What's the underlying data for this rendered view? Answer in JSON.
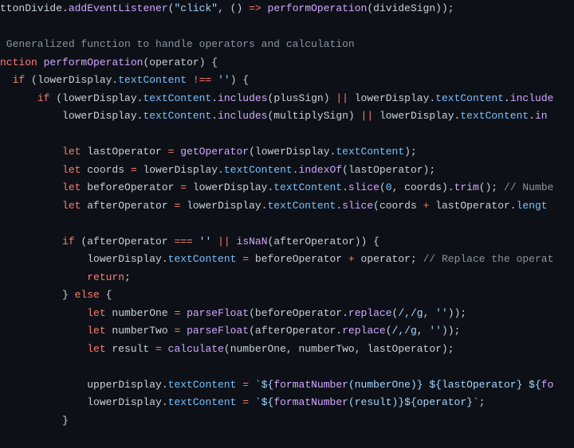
{
  "code": {
    "lines": [
      {
        "indent": 0,
        "segs": [
          {
            "c": "v",
            "t": "ttonDivide"
          },
          {
            "c": "p",
            "t": "."
          },
          {
            "c": "fn",
            "t": "addEventListener"
          },
          {
            "c": "p",
            "t": "("
          },
          {
            "c": "s",
            "t": "\"click\""
          },
          {
            "c": "p",
            "t": ", () "
          },
          {
            "c": "op",
            "t": "=>"
          },
          {
            "c": "p",
            "t": " "
          },
          {
            "c": "fn",
            "t": "performOperation"
          },
          {
            "c": "p",
            "t": "(divideSign));"
          }
        ]
      },
      {
        "indent": 0,
        "segs": []
      },
      {
        "indent": 0,
        "segs": [
          {
            "c": "c",
            "t": " Generalized function to handle operators and calculation"
          }
        ]
      },
      {
        "indent": 0,
        "segs": [
          {
            "c": "k",
            "t": "nction"
          },
          {
            "c": "p",
            "t": " "
          },
          {
            "c": "fn",
            "t": "performOperation"
          },
          {
            "c": "p",
            "t": "("
          },
          {
            "c": "v",
            "t": "operator"
          },
          {
            "c": "p",
            "t": ") {"
          }
        ]
      },
      {
        "indent": 2,
        "segs": [
          {
            "c": "k",
            "t": "if"
          },
          {
            "c": "p",
            "t": " (lowerDisplay."
          },
          {
            "c": "pr",
            "t": "textContent"
          },
          {
            "c": "p",
            "t": " "
          },
          {
            "c": "op",
            "t": "!=="
          },
          {
            "c": "p",
            "t": " "
          },
          {
            "c": "s",
            "t": "''"
          },
          {
            "c": "p",
            "t": ") {"
          }
        ]
      },
      {
        "indent": 6,
        "segs": [
          {
            "c": "k",
            "t": "if"
          },
          {
            "c": "p",
            "t": " (lowerDisplay."
          },
          {
            "c": "pr",
            "t": "textContent"
          },
          {
            "c": "p",
            "t": "."
          },
          {
            "c": "fn",
            "t": "includes"
          },
          {
            "c": "p",
            "t": "(plusSign) "
          },
          {
            "c": "op",
            "t": "||"
          },
          {
            "c": "p",
            "t": " lowerDisplay."
          },
          {
            "c": "pr",
            "t": "textContent"
          },
          {
            "c": "p",
            "t": "."
          },
          {
            "c": "fn",
            "t": "include"
          }
        ]
      },
      {
        "indent": 10,
        "segs": [
          {
            "c": "p",
            "t": "lowerDisplay."
          },
          {
            "c": "pr",
            "t": "textContent"
          },
          {
            "c": "p",
            "t": "."
          },
          {
            "c": "fn",
            "t": "includes"
          },
          {
            "c": "p",
            "t": "(multiplySign) "
          },
          {
            "c": "op",
            "t": "||"
          },
          {
            "c": "p",
            "t": " lowerDisplay."
          },
          {
            "c": "pr",
            "t": "textContent"
          },
          {
            "c": "p",
            "t": "."
          },
          {
            "c": "fn",
            "t": "in"
          }
        ]
      },
      {
        "indent": 0,
        "segs": []
      },
      {
        "indent": 10,
        "segs": [
          {
            "c": "k",
            "t": "let"
          },
          {
            "c": "p",
            "t": " lastOperator "
          },
          {
            "c": "op",
            "t": "="
          },
          {
            "c": "p",
            "t": " "
          },
          {
            "c": "fn",
            "t": "getOperator"
          },
          {
            "c": "p",
            "t": "(lowerDisplay."
          },
          {
            "c": "pr",
            "t": "textContent"
          },
          {
            "c": "p",
            "t": ");"
          }
        ]
      },
      {
        "indent": 10,
        "segs": [
          {
            "c": "k",
            "t": "let"
          },
          {
            "c": "p",
            "t": " coords "
          },
          {
            "c": "op",
            "t": "="
          },
          {
            "c": "p",
            "t": " lowerDisplay."
          },
          {
            "c": "pr",
            "t": "textContent"
          },
          {
            "c": "p",
            "t": "."
          },
          {
            "c": "fn",
            "t": "indexOf"
          },
          {
            "c": "p",
            "t": "(lastOperator);"
          }
        ]
      },
      {
        "indent": 10,
        "segs": [
          {
            "c": "k",
            "t": "let"
          },
          {
            "c": "p",
            "t": " beforeOperator "
          },
          {
            "c": "op",
            "t": "="
          },
          {
            "c": "p",
            "t": " lowerDisplay."
          },
          {
            "c": "pr",
            "t": "textContent"
          },
          {
            "c": "p",
            "t": "."
          },
          {
            "c": "fn",
            "t": "slice"
          },
          {
            "c": "p",
            "t": "("
          },
          {
            "c": "n",
            "t": "0"
          },
          {
            "c": "p",
            "t": ", coords)."
          },
          {
            "c": "fn",
            "t": "trim"
          },
          {
            "c": "p",
            "t": "(); "
          },
          {
            "c": "c",
            "t": "// Numbe"
          }
        ]
      },
      {
        "indent": 10,
        "segs": [
          {
            "c": "k",
            "t": "let"
          },
          {
            "c": "p",
            "t": " afterOperator "
          },
          {
            "c": "op",
            "t": "="
          },
          {
            "c": "p",
            "t": " lowerDisplay."
          },
          {
            "c": "pr",
            "t": "textContent"
          },
          {
            "c": "p",
            "t": "."
          },
          {
            "c": "fn",
            "t": "slice"
          },
          {
            "c": "p",
            "t": "(coords "
          },
          {
            "c": "op",
            "t": "+"
          },
          {
            "c": "p",
            "t": " lastOperator."
          },
          {
            "c": "pr",
            "t": "lengt"
          }
        ]
      },
      {
        "indent": 0,
        "segs": []
      },
      {
        "indent": 10,
        "segs": [
          {
            "c": "k",
            "t": "if"
          },
          {
            "c": "p",
            "t": " (afterOperator "
          },
          {
            "c": "op",
            "t": "==="
          },
          {
            "c": "p",
            "t": " "
          },
          {
            "c": "s",
            "t": "''"
          },
          {
            "c": "p",
            "t": " "
          },
          {
            "c": "op",
            "t": "||"
          },
          {
            "c": "p",
            "t": " "
          },
          {
            "c": "fn",
            "t": "isNaN"
          },
          {
            "c": "p",
            "t": "(afterOperator)) {"
          }
        ]
      },
      {
        "indent": 14,
        "segs": [
          {
            "c": "p",
            "t": "lowerDisplay."
          },
          {
            "c": "pr",
            "t": "textContent"
          },
          {
            "c": "p",
            "t": " "
          },
          {
            "c": "op",
            "t": "="
          },
          {
            "c": "p",
            "t": " beforeOperator "
          },
          {
            "c": "op",
            "t": "+"
          },
          {
            "c": "p",
            "t": " operator; "
          },
          {
            "c": "c",
            "t": "// Replace the operat"
          }
        ]
      },
      {
        "indent": 14,
        "segs": [
          {
            "c": "k",
            "t": "return"
          },
          {
            "c": "p",
            "t": ";"
          }
        ]
      },
      {
        "indent": 10,
        "segs": [
          {
            "c": "p",
            "t": "} "
          },
          {
            "c": "k",
            "t": "else"
          },
          {
            "c": "p",
            "t": " {"
          }
        ]
      },
      {
        "indent": 14,
        "segs": [
          {
            "c": "k",
            "t": "let"
          },
          {
            "c": "p",
            "t": " numberOne "
          },
          {
            "c": "op",
            "t": "="
          },
          {
            "c": "p",
            "t": " "
          },
          {
            "c": "fn",
            "t": "parseFloat"
          },
          {
            "c": "p",
            "t": "(beforeOperator."
          },
          {
            "c": "fn",
            "t": "replace"
          },
          {
            "c": "p",
            "t": "("
          },
          {
            "c": "rx",
            "t": "/,/g"
          },
          {
            "c": "p",
            "t": ", "
          },
          {
            "c": "s",
            "t": "''"
          },
          {
            "c": "p",
            "t": "));"
          }
        ]
      },
      {
        "indent": 14,
        "segs": [
          {
            "c": "k",
            "t": "let"
          },
          {
            "c": "p",
            "t": " numberTwo "
          },
          {
            "c": "op",
            "t": "="
          },
          {
            "c": "p",
            "t": " "
          },
          {
            "c": "fn",
            "t": "parseFloat"
          },
          {
            "c": "p",
            "t": "(afterOperator."
          },
          {
            "c": "fn",
            "t": "replace"
          },
          {
            "c": "p",
            "t": "("
          },
          {
            "c": "rx",
            "t": "/,/g"
          },
          {
            "c": "p",
            "t": ", "
          },
          {
            "c": "s",
            "t": "''"
          },
          {
            "c": "p",
            "t": "));"
          }
        ]
      },
      {
        "indent": 14,
        "segs": [
          {
            "c": "k",
            "t": "let"
          },
          {
            "c": "p",
            "t": " result "
          },
          {
            "c": "op",
            "t": "="
          },
          {
            "c": "p",
            "t": " "
          },
          {
            "c": "fn",
            "t": "calculate"
          },
          {
            "c": "p",
            "t": "(numberOne, numberTwo, lastOperator);"
          }
        ]
      },
      {
        "indent": 0,
        "segs": []
      },
      {
        "indent": 14,
        "segs": [
          {
            "c": "p",
            "t": "upperDisplay."
          },
          {
            "c": "pr",
            "t": "textContent"
          },
          {
            "c": "p",
            "t": " "
          },
          {
            "c": "op",
            "t": "="
          },
          {
            "c": "p",
            "t": " "
          },
          {
            "c": "s",
            "t": "`${"
          },
          {
            "c": "fn",
            "t": "formatNumber"
          },
          {
            "c": "s",
            "t": "(numberOne)} ${lastOperator} ${"
          },
          {
            "c": "fn",
            "t": "fo"
          }
        ]
      },
      {
        "indent": 14,
        "segs": [
          {
            "c": "p",
            "t": "lowerDisplay."
          },
          {
            "c": "pr",
            "t": "textContent"
          },
          {
            "c": "p",
            "t": " "
          },
          {
            "c": "op",
            "t": "="
          },
          {
            "c": "p",
            "t": " "
          },
          {
            "c": "s",
            "t": "`${"
          },
          {
            "c": "fn",
            "t": "formatNumber"
          },
          {
            "c": "s",
            "t": "(result)}${operator}`"
          },
          {
            "c": "p",
            "t": ";"
          }
        ]
      },
      {
        "indent": 10,
        "segs": [
          {
            "c": "p",
            "t": "}"
          }
        ]
      }
    ]
  }
}
